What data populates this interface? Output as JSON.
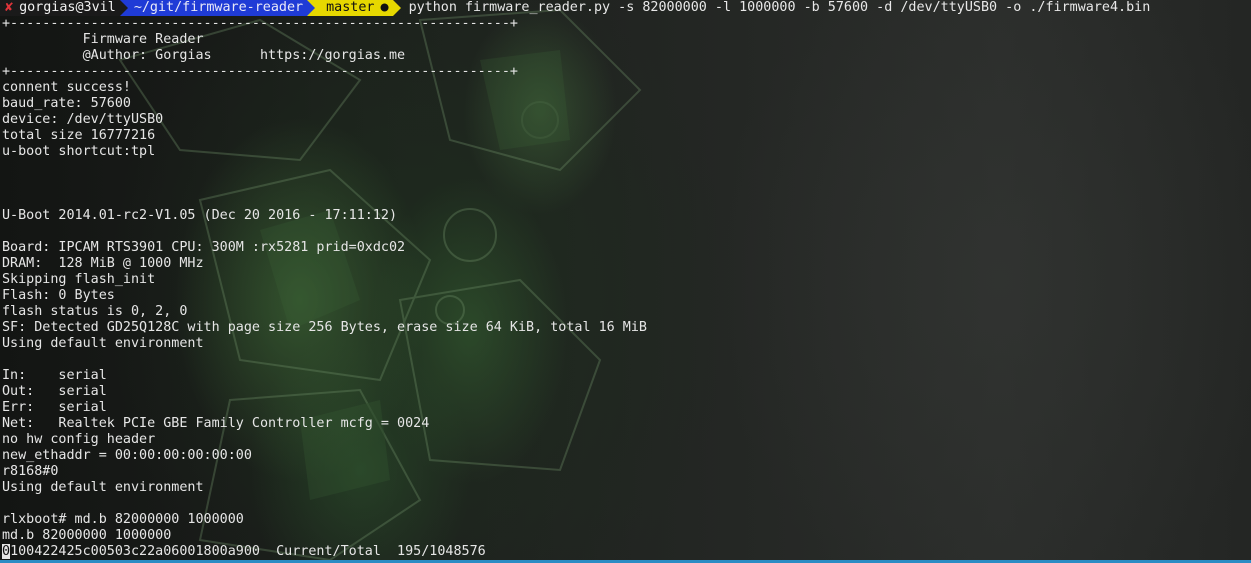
{
  "prompt": {
    "status_glyph": "✘",
    "user_host": "gorgias@3vil",
    "directory": "~/git/firmware-reader",
    "branch_glyph": "",
    "branch": "master",
    "dirty_glyph": "●",
    "command": "python firmware_reader.py -s 82000000 -l 1000000 -b 57600 -d /dev/ttyUSB0 -o ./firmware4.bin",
    "colors": {
      "error": "#e0343a",
      "user_bg": "#1a1a1a",
      "dir_bg": "#1f3bd6",
      "git_bg": "#e6d800"
    }
  },
  "output": {
    "lines": [
      "+--------------------------------------------------------------+",
      "          Firmware Reader",
      "          @Author: Gorgias      https://gorgias.me",
      "+--------------------------------------------------------------+",
      "connent success!",
      "baud_rate: 57600",
      "device: /dev/ttyUSB0",
      "total size 16777216",
      "u-boot shortcut:tpl",
      "",
      "",
      "",
      "U-Boot 2014.01-rc2-V1.05 (Dec 20 2016 - 17:11:12)",
      "",
      "Board: IPCAM RTS3901 CPU: 300M :rx5281 prid=0xdc02",
      "DRAM:  128 MiB @ 1000 MHz",
      "Skipping flash_init",
      "Flash: 0 Bytes",
      "flash status is 0, 2, 0",
      "SF: Detected GD25Q128C with page size 256 Bytes, erase size 64 KiB, total 16 MiB",
      "Using default environment",
      "",
      "In:    serial",
      "Out:   serial",
      "Err:   serial",
      "Net:   Realtek PCIe GBE Family Controller mcfg = 0024",
      "no hw config header",
      "new_ethaddr = 00:00:00:00:00:00",
      "r8168#0",
      "Using default environment",
      "",
      "rlxboot# md.b 82000000 1000000",
      "md.b 82000000 1000000"
    ],
    "cursor_char": "0",
    "last_line": "100422425c00503c22a06001800a900  Current/Total  195/1048576"
  },
  "accent_strip_color": "#2b8cc4"
}
